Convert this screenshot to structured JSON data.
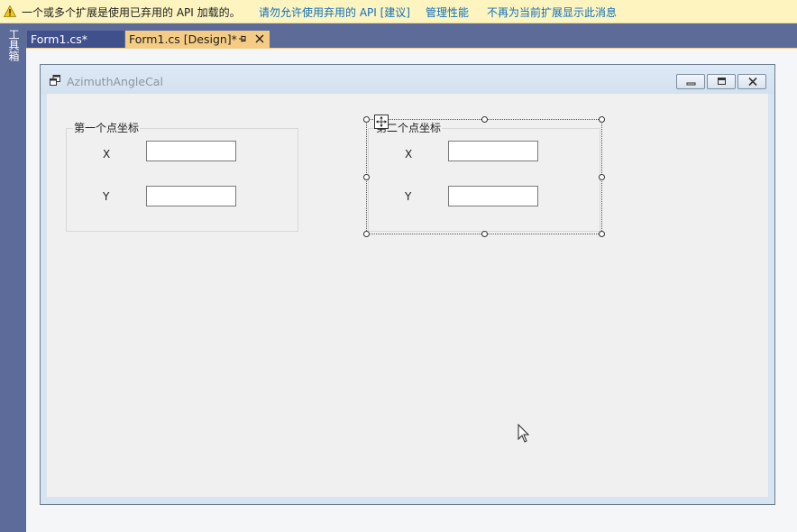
{
  "infobar": {
    "message": "一个或多个扩展是使用已弃用的 API 加载的。",
    "link_allow": "请勿允许使用弃用的 API [建议]",
    "link_manage": "管理性能",
    "link_dismiss": "不再为当前扩展显示此消息",
    "icon": "warning-icon"
  },
  "toolbox": {
    "label": "工具箱"
  },
  "tabs": [
    {
      "label": "Form1.cs*"
    },
    {
      "label": "Form1.cs [Design]*"
    }
  ],
  "form": {
    "title": "AzimuthAngleCal",
    "groups": [
      {
        "legend": "第一个点坐标",
        "x_label": "X",
        "y_label": "Y",
        "x_value": "",
        "y_value": ""
      },
      {
        "legend": "第二个点坐标",
        "x_label": "X",
        "y_label": "Y",
        "x_value": "",
        "y_value": ""
      }
    ]
  },
  "colors": {
    "infobar_bg": "#fdf4bf",
    "link": "#0e70c0",
    "chrome": "#5d6b99",
    "active_tab": "#f5cc84",
    "inactive_tab": "#40508d"
  }
}
